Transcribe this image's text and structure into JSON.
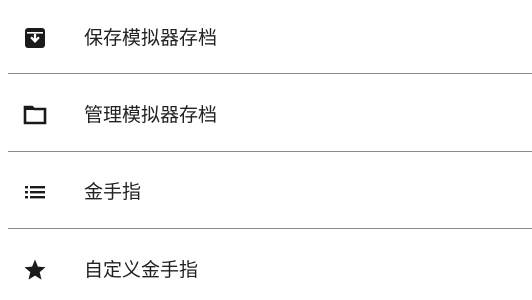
{
  "menu": {
    "items": [
      {
        "label": "保存模拟器存档",
        "icon": "archive-save-icon"
      },
      {
        "label": "管理模拟器存档",
        "icon": "folder-icon"
      },
      {
        "label": "金手指",
        "icon": "list-icon"
      },
      {
        "label": "自定义金手指",
        "icon": "star-icon"
      }
    ]
  },
  "colors": {
    "icon": "#1a1a1a",
    "text": "#222222",
    "divider": "#8a8a8a",
    "background": "#ffffff"
  }
}
